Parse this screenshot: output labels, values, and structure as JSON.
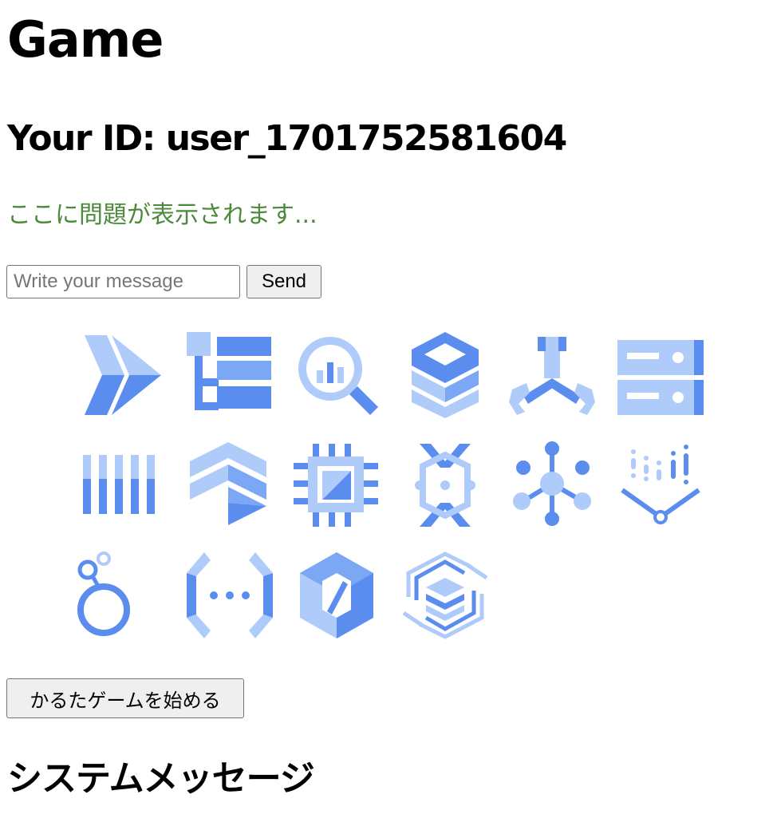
{
  "page": {
    "title": "Game",
    "user_id_label": "Your ID: user_1701752581604",
    "question_text": "ここに問題が表示されます..."
  },
  "chat": {
    "input_value": "",
    "input_placeholder": "Write your message",
    "send_label": "Send"
  },
  "icons": [
    {
      "name": "dataflow-icon"
    },
    {
      "name": "data-catalog-icon"
    },
    {
      "name": "bigquery-icon"
    },
    {
      "name": "cloud-storage-icon"
    },
    {
      "name": "tools-icon"
    },
    {
      "name": "filestore-icon"
    },
    {
      "name": "pubsub-columns-icon"
    },
    {
      "name": "deployment-manager-icon"
    },
    {
      "name": "compute-engine-icon"
    },
    {
      "name": "dataproc-icon"
    },
    {
      "name": "network-hub-icon"
    },
    {
      "name": "vertex-ai-icon"
    },
    {
      "name": "looker-icon"
    },
    {
      "name": "cloud-functions-icon"
    },
    {
      "name": "security-hexagon-icon"
    },
    {
      "name": "spiral-stack-icon"
    }
  ],
  "karuta": {
    "start_label": "かるたゲームを始める"
  },
  "system": {
    "heading": "システムメッセージ"
  },
  "colors": {
    "question": "#4b8a3b",
    "icon_dark": "#5b8def",
    "icon_light": "#aecbfa",
    "icon_mid": "#7ba7f5"
  }
}
